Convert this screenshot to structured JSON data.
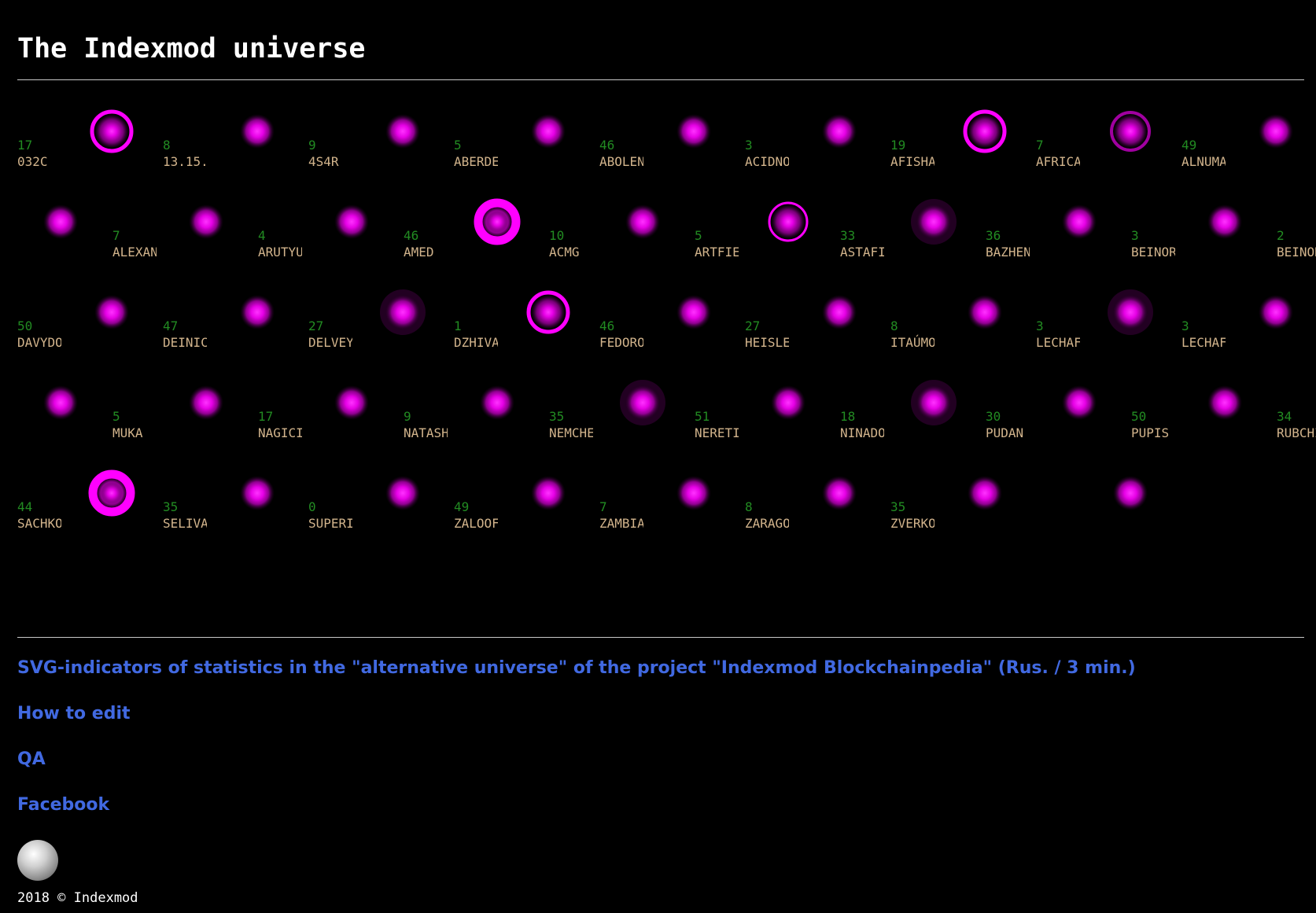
{
  "header": {
    "title": "The Indexmod universe"
  },
  "colors": {
    "background": "#000000",
    "count": "#228b22",
    "name": "#d2b48c",
    "orb": "#ff00ff",
    "link": "#4169e1"
  },
  "universe": {
    "entries": [
      {
        "count": "17",
        "name": "032C",
        "ring": "thick"
      },
      {
        "count": "8",
        "name": "13.15.",
        "ring": "none"
      },
      {
        "count": "9",
        "name": "4S4R",
        "ring": "none"
      },
      {
        "count": "5",
        "name": "ABERDE",
        "ring": "none"
      },
      {
        "count": "46",
        "name": "ABOLEN",
        "ring": "none"
      },
      {
        "count": "3",
        "name": "ACIDNO",
        "ring": "none"
      },
      {
        "count": "19",
        "name": "AFISHA",
        "ring": "thick"
      },
      {
        "count": "7",
        "name": "AFRICA",
        "ring": "dim"
      },
      {
        "count": "49",
        "name": "ALNUMA",
        "ring": "none"
      },
      {
        "count": "7",
        "name": "ALEXAN",
        "ring": "none"
      },
      {
        "count": "4",
        "name": "ARUTYU",
        "ring": "none"
      },
      {
        "count": "46",
        "name": "AMED",
        "ring": "none"
      },
      {
        "count": "10",
        "name": "ACMG",
        "ring": "heavy"
      },
      {
        "count": "5",
        "name": "ARTFIE",
        "ring": "none"
      },
      {
        "count": "33",
        "name": "ASTAFI",
        "ring": "thin"
      },
      {
        "count": "36",
        "name": "BAZHEN",
        "ring": "halo"
      },
      {
        "count": "3",
        "name": "BEINOR",
        "ring": "none"
      },
      {
        "count": "2",
        "name": "BEINOR",
        "ring": "none"
      },
      {
        "count": "50",
        "name": "DAVYDO",
        "ring": "none"
      },
      {
        "count": "47",
        "name": "DEINIC",
        "ring": "none"
      },
      {
        "count": "27",
        "name": "DELVEY",
        "ring": "halo"
      },
      {
        "count": "1",
        "name": "DZHIVA",
        "ring": "thick"
      },
      {
        "count": "46",
        "name": "FEDORO",
        "ring": "none"
      },
      {
        "count": "27",
        "name": "HEISLE",
        "ring": "none"
      },
      {
        "count": "8",
        "name": "ITAÚMO",
        "ring": "none"
      },
      {
        "count": "3",
        "name": "LECHAF",
        "ring": "halo"
      },
      {
        "count": "3",
        "name": "LECHAF",
        "ring": "none"
      },
      {
        "count": "5",
        "name": "MUKA",
        "ring": "none"
      },
      {
        "count": "17",
        "name": "NAGICI",
        "ring": "none"
      },
      {
        "count": "9",
        "name": "NATASH",
        "ring": "none"
      },
      {
        "count": "35",
        "name": "NEMCHE",
        "ring": "none"
      },
      {
        "count": "51",
        "name": "NERETI",
        "ring": "halo"
      },
      {
        "count": "18",
        "name": "NINADO",
        "ring": "none"
      },
      {
        "count": "30",
        "name": "PUDAN",
        "ring": "halo"
      },
      {
        "count": "50",
        "name": "PUPIS",
        "ring": "none"
      },
      {
        "count": "34",
        "name": "RUBCHI",
        "ring": "none"
      },
      {
        "count": "44",
        "name": "SACHKO",
        "ring": "heavy"
      },
      {
        "count": "35",
        "name": "SELIVA",
        "ring": "none"
      },
      {
        "count": "0",
        "name": "SUPERI",
        "ring": "none"
      },
      {
        "count": "49",
        "name": "ZALOOF",
        "ring": "none"
      },
      {
        "count": "7",
        "name": "ZAMBIA",
        "ring": "none"
      },
      {
        "count": "8",
        "name": "ZARAGO",
        "ring": "none"
      },
      {
        "count": "35",
        "name": "ZVERKO",
        "ring": "none"
      },
      {
        "count": "",
        "name": "",
        "ring": "none"
      }
    ]
  },
  "links": [
    {
      "label": "SVG-indicators of statistics in the \"alternative universe\" of the project \"Indexmod Blockchainpedia\" (Rus. / 3 min.)"
    },
    {
      "label": "How to edit"
    },
    {
      "label": "QA"
    },
    {
      "label": "Facebook"
    }
  ],
  "footer": {
    "copyright": "2018 © Indexmod"
  }
}
